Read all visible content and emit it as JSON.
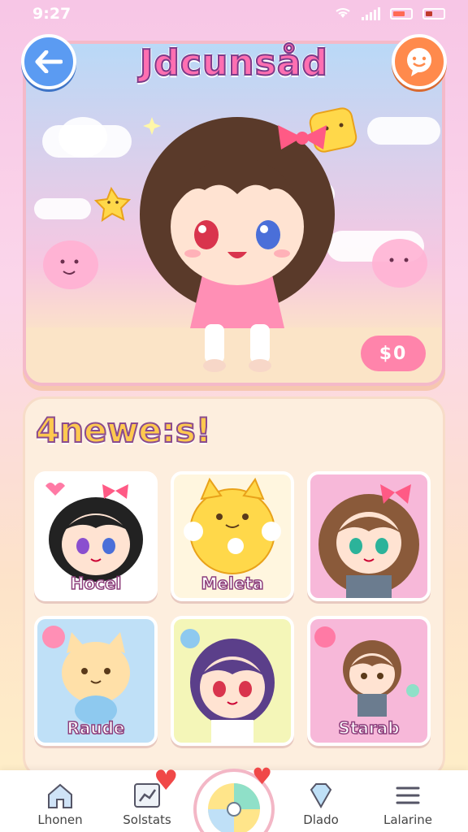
{
  "status_bar": {
    "time": "9:27"
  },
  "header": {
    "title": "Jdcunsåd"
  },
  "hero": {
    "price_label": "$0"
  },
  "section": {
    "title": "4newe:s!"
  },
  "characters": [
    {
      "name": "Hocel",
      "bg": "#ffffff"
    },
    {
      "name": "Meleta",
      "bg": "#fff6df"
    },
    {
      "name": "",
      "bg": "#f7b8d9"
    },
    {
      "name": "Raude",
      "bg": "#bfe0f7"
    },
    {
      "name": "",
      "bg": "#f4f6b8"
    },
    {
      "name": "Starab",
      "bg": "#f7b8d9"
    }
  ],
  "nav": [
    {
      "label": "Lhonen",
      "icon": "home-icon"
    },
    {
      "label": "Solstats",
      "icon": "stats-icon"
    },
    {
      "label": "Dlado",
      "icon": "gem-icon"
    },
    {
      "label": "Lalarine",
      "icon": "menu-icon"
    }
  ],
  "colors": {
    "accent": "#ff6fb1",
    "back_button": "#5b9bf2",
    "chat_button": "#ff8a4c"
  }
}
